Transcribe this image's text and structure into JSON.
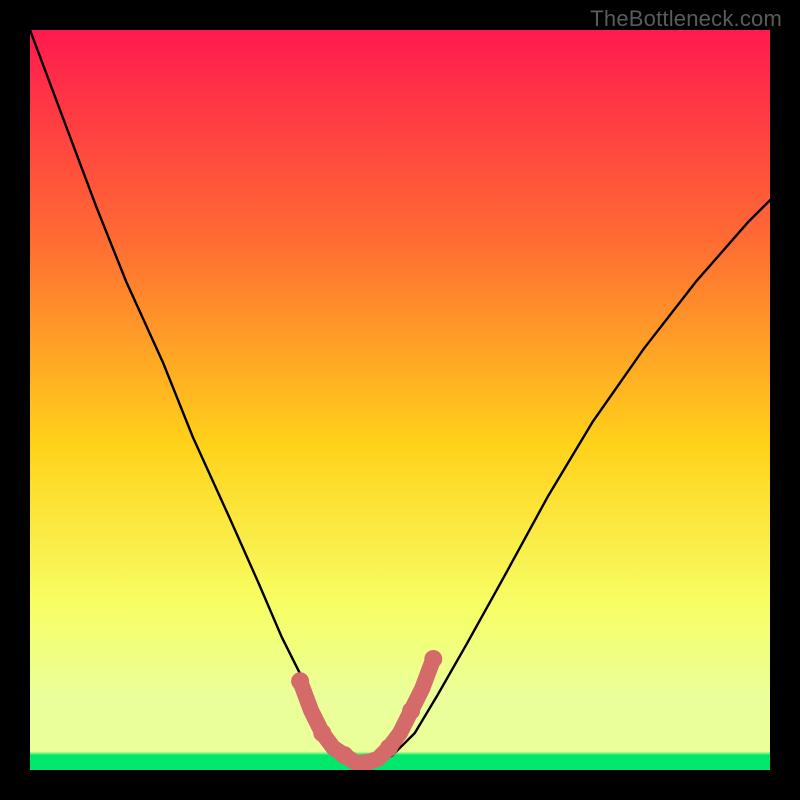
{
  "watermark": "TheBottleneck.com",
  "colors": {
    "frame": "#000000",
    "grad_top": "#ff1a4f",
    "grad_upper_mid": "#ff6a33",
    "grad_mid": "#ffd21a",
    "grad_lower_mid": "#f7ff66",
    "grad_band": "#eaff9a",
    "grad_green": "#00e86b",
    "curve": "#000000",
    "marker": "#d46a6a"
  },
  "chart_data": {
    "type": "line",
    "title": "",
    "xlabel": "",
    "ylabel": "",
    "xlim": [
      0,
      100
    ],
    "ylim": [
      0,
      100
    ],
    "grid": false,
    "series": [
      {
        "name": "bottleneck-curve",
        "x": [
          0,
          3,
          6,
          9,
          13,
          18,
          22,
          27,
          31,
          34,
          37,
          39,
          41,
          43,
          45,
          47,
          49,
          52,
          55,
          59,
          64,
          70,
          76,
          83,
          90,
          97,
          100
        ],
        "y": [
          100,
          92,
          84,
          76,
          66,
          55,
          45,
          34,
          25,
          18,
          12,
          7,
          4,
          2,
          1,
          1,
          2,
          5,
          10,
          17,
          26,
          37,
          47,
          57,
          66,
          74,
          77
        ]
      }
    ],
    "markers": {
      "name": "highlight-segment",
      "x": [
        36.5,
        38,
        39.5,
        41,
        42.5,
        44,
        45.5,
        47,
        48.5,
        50,
        51.5,
        53,
        54.5
      ],
      "y": [
        12,
        8,
        5,
        3,
        2,
        1,
        1,
        1.5,
        3,
        5,
        8,
        11,
        15
      ]
    }
  }
}
